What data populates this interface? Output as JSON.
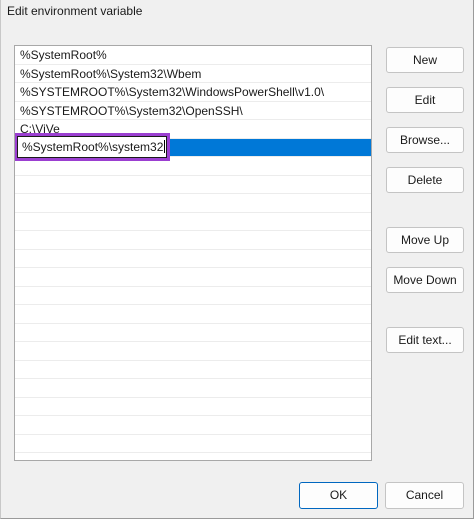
{
  "window": {
    "title": "Edit environment variable"
  },
  "paths": {
    "items": [
      "%SystemRoot%",
      "%SystemRoot%\\System32\\Wbem",
      "%SYSTEMROOT%\\System32\\WindowsPowerShell\\v1.0\\",
      "%SYSTEMROOT%\\System32\\OpenSSH\\",
      "C:\\ViVe"
    ],
    "editing_value": "%SystemRoot%\\system32"
  },
  "buttons": {
    "new": "New",
    "edit": "Edit",
    "browse": "Browse...",
    "delete": "Delete",
    "move_up": "Move Up",
    "move_down": "Move Down",
    "edit_text": "Edit text...",
    "ok": "OK",
    "cancel": "Cancel"
  },
  "colors": {
    "selection": "#0078d7",
    "highlight_outline": "#9b3fd1",
    "ok_border": "#0067c0"
  }
}
